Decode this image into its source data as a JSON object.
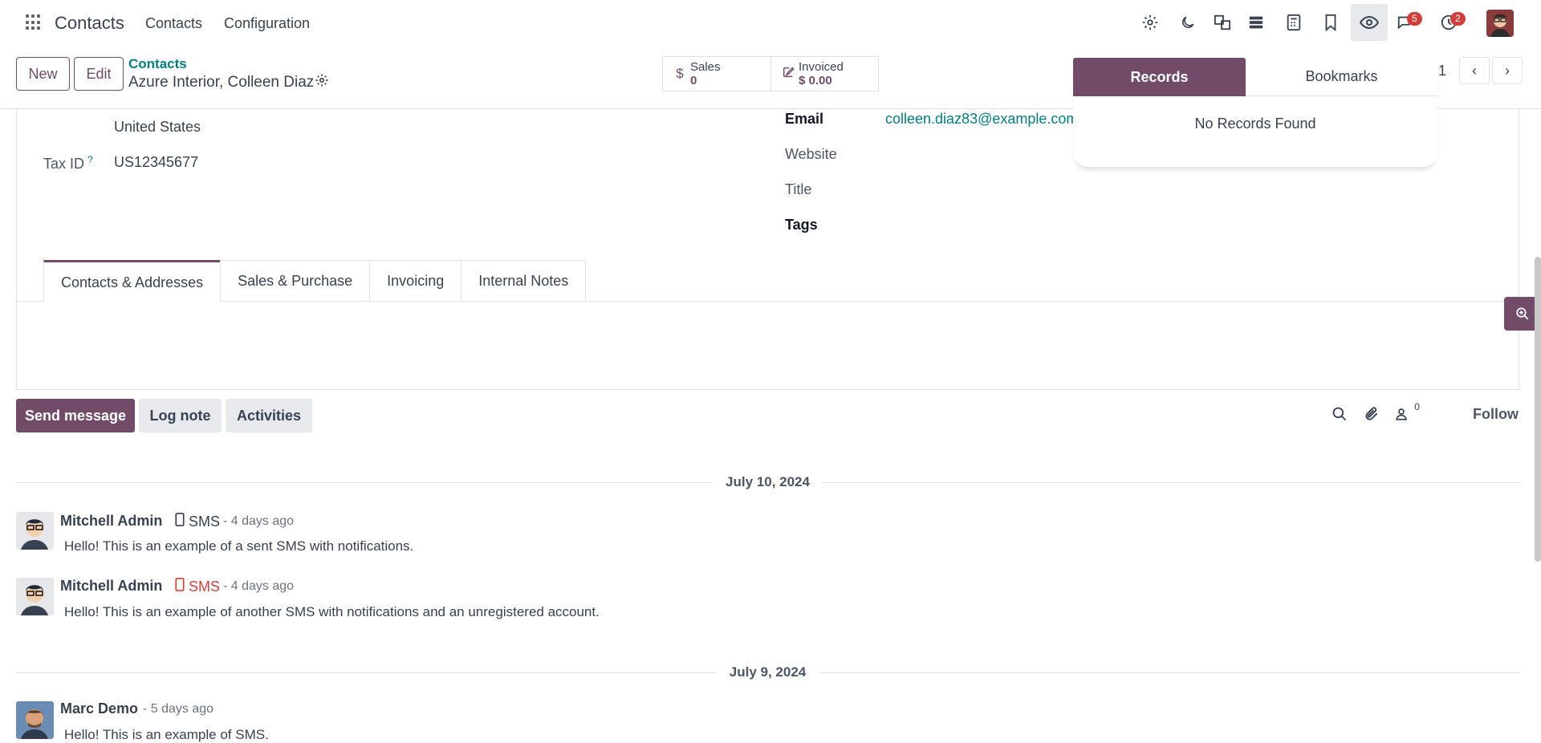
{
  "navbar": {
    "app_name": "Contacts",
    "menu": [
      "Contacts",
      "Configuration"
    ],
    "systray": {
      "messages_count": "5",
      "activities_count": "2"
    }
  },
  "control_panel": {
    "new_label": "New",
    "edit_label": "Edit",
    "breadcrumb": "Contacts",
    "record_name": "Azure Interior, Colleen Diaz",
    "sales": {
      "label": "Sales",
      "value": "0"
    },
    "invoiced": {
      "label": "Invoiced",
      "value": "$ 0.00"
    },
    "pager": "1"
  },
  "popup": {
    "tab_records": "Records",
    "tab_bookmarks": "Bookmarks",
    "empty": "No Records Found"
  },
  "form": {
    "country": "United States",
    "tax_id_label": "Tax ID",
    "tax_id_help": "?",
    "tax_id": "US12345677",
    "email_label": "Email",
    "email": "colleen.diaz83@example.com",
    "website_label": "Website",
    "title_label": "Title",
    "tags_label": "Tags",
    "tabs": [
      "Contacts & Addresses",
      "Sales & Purchase",
      "Invoicing",
      "Internal Notes"
    ]
  },
  "chatter": {
    "send_message": "Send message",
    "log_note": "Log note",
    "activities": "Activities",
    "followers_count": "0",
    "follow": "Follow",
    "groups": [
      {
        "date": "July 10, 2024",
        "messages": [
          {
            "author": "Mitchell Admin",
            "type": "SMS",
            "time": "- 4 days ago",
            "body": "Hello! This is an example of a sent SMS with notifications.",
            "error": false
          },
          {
            "author": "Mitchell Admin",
            "type": "SMS",
            "time": "- 4 days ago",
            "body": "Hello! This is an example of another SMS with notifications and an unregistered account.",
            "error": true
          }
        ]
      },
      {
        "date": "July 9, 2024",
        "messages": [
          {
            "author": "Marc Demo",
            "type": "",
            "time": "- 5 days ago",
            "body": "Hello! This is an example of SMS.",
            "error": false
          }
        ]
      }
    ]
  }
}
